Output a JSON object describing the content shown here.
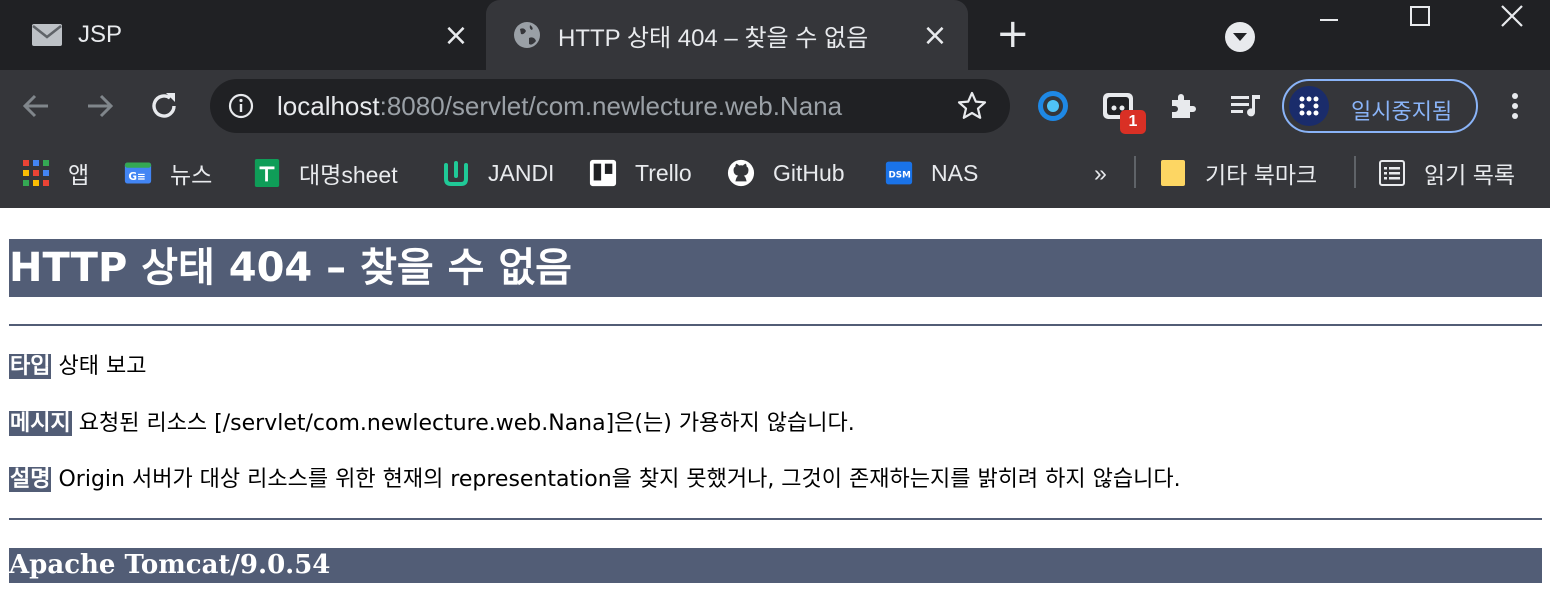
{
  "tabs": [
    {
      "title": "JSP",
      "icon": "mail-icon",
      "active": false
    },
    {
      "title": "HTTP 상태 404 – 찾을 수 없음",
      "icon": "globe-icon",
      "active": true
    }
  ],
  "toolbar": {
    "url_host": "localhost",
    "url_rest": ":8080/servlet/com.newlecture.web.Nana",
    "extension_badge": "1",
    "profile_label": "일시중지됨"
  },
  "bookmarks": [
    {
      "label": "앱",
      "icon": "apps-grid-icon"
    },
    {
      "label": "뉴스",
      "icon": "news-icon"
    },
    {
      "label": "대명sheet",
      "icon": "sheets-icon"
    },
    {
      "label": "JANDI",
      "icon": "jandi-icon"
    },
    {
      "label": "Trello",
      "icon": "trello-icon"
    },
    {
      "label": "GitHub",
      "icon": "github-icon"
    },
    {
      "label": "NAS",
      "icon": "dsm-icon"
    }
  ],
  "bookmarks_overflow": "»",
  "other_bookmarks": "기타 북마크",
  "reading_list": "읽기 목록",
  "page": {
    "heading": "HTTP 상태 404 – 찾을 수 없음",
    "type_label": "타입",
    "type_value": "상태 보고",
    "message_label": "메시지",
    "message_value": "요청된 리소스 [/servlet/com.newlecture.web.Nana]은(는) 가용하지 않습니다.",
    "description_label": "설명",
    "description_value": "Origin 서버가 대상 리소스를 위한 현재의 representation을 찾지 못했거나, 그것이 존재하는지를 밝히려 하지 않습니다.",
    "footer": "Apache Tomcat/9.0.54"
  },
  "colors": {
    "tomcat_header": "#525d76",
    "chrome_dark": "#202124",
    "chrome_toolbar": "#35363a",
    "accent_blue": "#8ab4f8"
  }
}
